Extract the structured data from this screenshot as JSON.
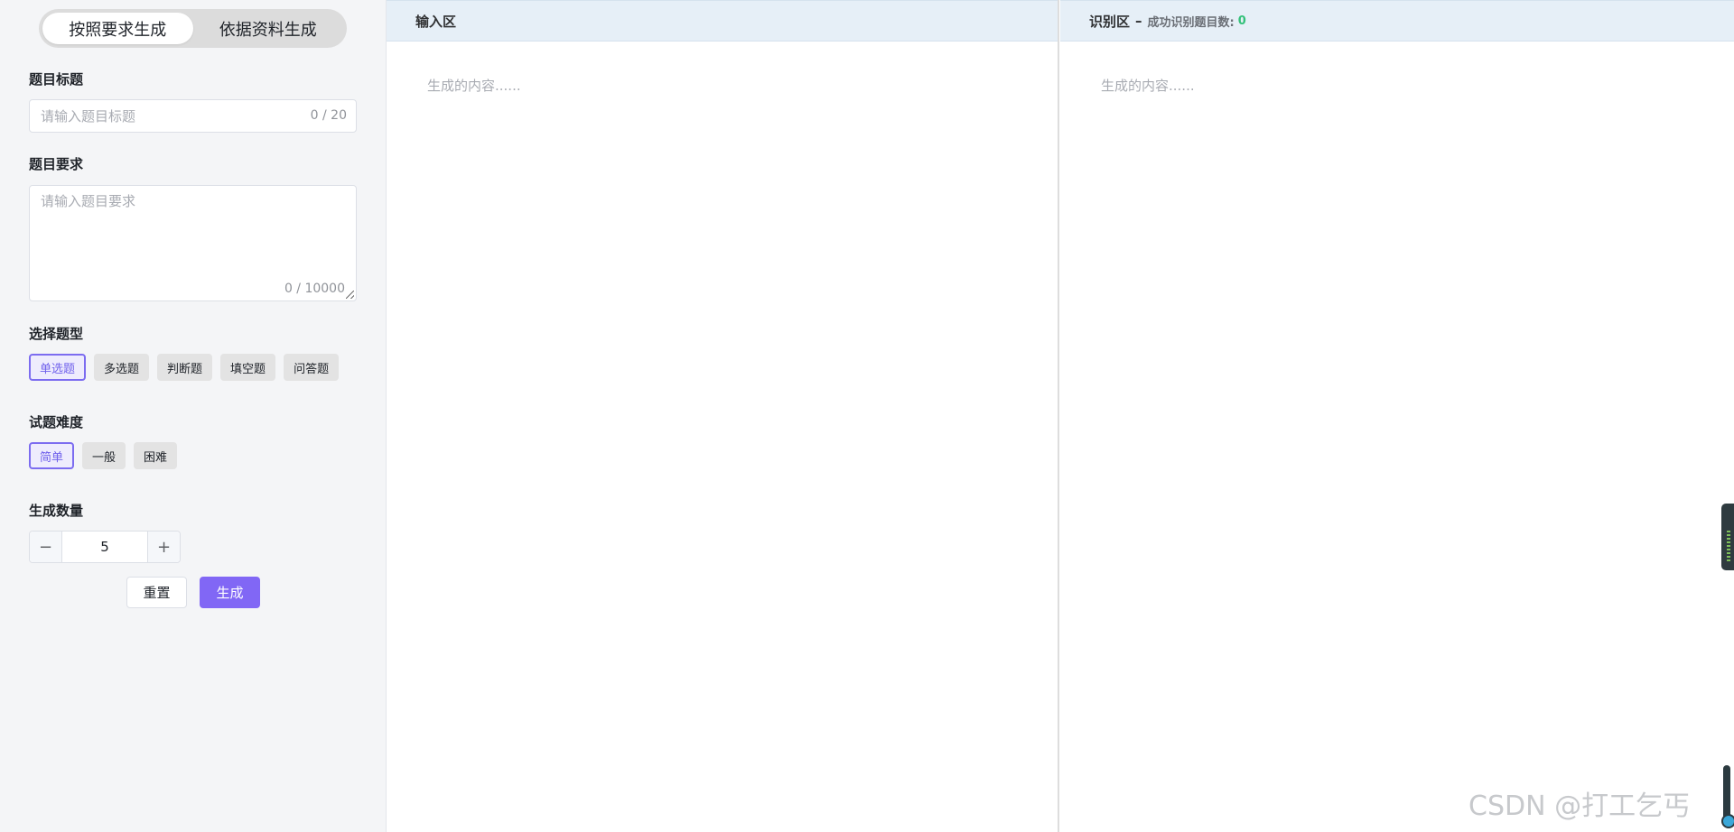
{
  "mode_toggle": {
    "options": [
      "按照要求生成",
      "依据资料生成"
    ],
    "active_index": 0
  },
  "form": {
    "title": {
      "label": "题目标题",
      "placeholder": "请输入题目标题",
      "value": "",
      "counter": "0 / 20"
    },
    "requirement": {
      "label": "题目要求",
      "placeholder": "请输入题目要求",
      "value": "",
      "counter": "0 / 10000"
    },
    "question_type": {
      "label": "选择题型",
      "options": [
        "单选题",
        "多选题",
        "判断题",
        "填空题",
        "问答题"
      ],
      "selected": "单选题"
    },
    "difficulty": {
      "label": "试题难度",
      "options": [
        "简单",
        "一般",
        "困难"
      ],
      "selected": "简单"
    },
    "quantity": {
      "label": "生成数量",
      "minus": "−",
      "plus": "+",
      "value": "5"
    },
    "reset_label": "重置",
    "generate_label": "生成"
  },
  "input_panel": {
    "title": "输入区",
    "placeholder": "生成的内容......"
  },
  "recognition_panel": {
    "title": "识别区",
    "separator": "–",
    "subtitle": "成功识别题目数:",
    "count": "0",
    "placeholder": "生成的内容......"
  },
  "watermark": "CSDN @打工乞丐",
  "colors": {
    "accent": "#8167f5",
    "header_bg": "#e6eff7",
    "sidebar_bg": "#f4f5f7",
    "success_count": "#34c17a"
  }
}
